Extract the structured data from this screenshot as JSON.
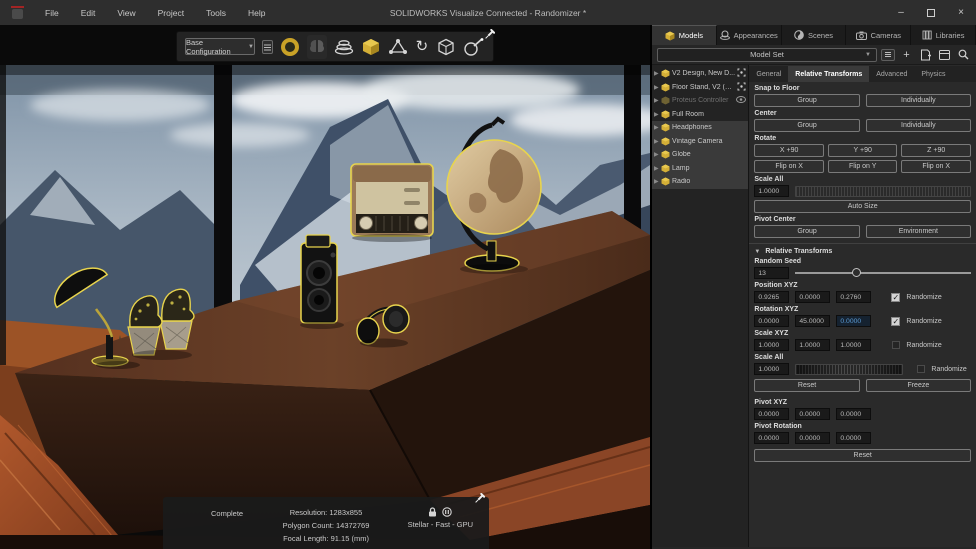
{
  "titlebar": {
    "menus": [
      "File",
      "Edit",
      "View",
      "Project",
      "Tools",
      "Help"
    ],
    "title": "SOLIDWORKS Visualize Connected - Randomizer *",
    "window_controls": {
      "minimize": "–",
      "close": "×"
    }
  },
  "toolbar": {
    "configuration_value": "Base Configuration",
    "icons": [
      "configuration-list",
      "render-ring",
      "ai-brain",
      "denoiser-stack",
      "model-cube",
      "triad-move",
      "rotate",
      "bounding-box",
      "randomizer-wand",
      "pin"
    ]
  },
  "right_panel": {
    "tabs": [
      {
        "label": "Models",
        "active": true
      },
      {
        "label": "Appearances",
        "active": false
      },
      {
        "label": "Scenes",
        "active": false
      },
      {
        "label": "Cameras",
        "active": false
      },
      {
        "label": "Libraries",
        "active": false
      }
    ],
    "model_set": {
      "value": "Model Set"
    },
    "tree": {
      "items": [
        {
          "label": "V2 Design, New D...",
          "trailing": "target",
          "dimmed": false,
          "selected": false
        },
        {
          "label": "Floor Stand, V2 (D...",
          "trailing": "target",
          "dimmed": false,
          "selected": false
        },
        {
          "label": "Proteus Controller",
          "trailing": "eye",
          "dimmed": true,
          "selected": false
        },
        {
          "label": "Full Room",
          "trailing": "",
          "dimmed": false,
          "selected": false
        },
        {
          "label": "Headphones",
          "trailing": "",
          "dimmed": false,
          "selected": true
        },
        {
          "label": "Vintage Camera",
          "trailing": "",
          "dimmed": false,
          "selected": true
        },
        {
          "label": "Globe",
          "trailing": "",
          "dimmed": false,
          "selected": true
        },
        {
          "label": "Lamp",
          "trailing": "",
          "dimmed": false,
          "selected": true
        },
        {
          "label": "Radio",
          "trailing": "",
          "dimmed": false,
          "selected": true
        }
      ]
    },
    "props_tabs": [
      {
        "label": "General",
        "active": false
      },
      {
        "label": "Relative Transforms",
        "active": true
      },
      {
        "label": "Advanced",
        "active": false
      },
      {
        "label": "Physics",
        "active": false
      }
    ],
    "sections": {
      "snap_to_floor": {
        "label": "Snap to Floor",
        "buttons": [
          "Group",
          "Individually"
        ]
      },
      "center": {
        "label": "Center",
        "buttons": [
          "Group",
          "Individually"
        ]
      },
      "rotate": {
        "label": "Rotate",
        "row1": [
          "X +90",
          "Y +90",
          "Z +90"
        ],
        "row2": [
          "Flip on X",
          "Flip on Y",
          "Flip on X"
        ]
      },
      "scale_all": {
        "label": "Scale All",
        "value": "1.0000"
      },
      "auto_size_label": "Auto Size",
      "pivot_center": {
        "label": "Pivot Center",
        "buttons": [
          "Group",
          "Environment"
        ]
      },
      "relative_transforms": {
        "header": "Relative Transforms",
        "random_seed": {
          "label": "Random Seed",
          "value": "13"
        },
        "position": {
          "label": "Position XYZ",
          "values": [
            "0.9265",
            "0.0000",
            "0.2760"
          ],
          "randomize": true
        },
        "rotation": {
          "label": "Rotation XYZ",
          "values": [
            "0.0000",
            "45.0000",
            "0.0000"
          ],
          "randomize": true,
          "highlighted_field": 2
        },
        "scale_xyz": {
          "label": "Scale XYZ",
          "values": [
            "1.0000",
            "1.0000",
            "1.0000"
          ],
          "randomize": false
        },
        "scale_all": {
          "label": "Scale All",
          "value": "1.0000",
          "randomize": false
        },
        "reset_label": "Reset",
        "freeze_label": "Freeze",
        "pivot_xyz": {
          "label": "Pivot XYZ",
          "values": [
            "0.0000",
            "0.0000",
            "0.0000"
          ]
        },
        "pivot_rotation": {
          "label": "Pivot Rotation",
          "values": [
            "0.0000",
            "0.0000",
            "0.0000"
          ]
        },
        "reset_bottom_label": "Reset"
      },
      "randomize_label": "Randomize"
    }
  },
  "status_bar": {
    "left": "Complete",
    "resolution": "Resolution: 1283x855",
    "polygon_count": "Polygon Count: 14372769",
    "focal_length": "Focal Length: 91.15 (mm)",
    "renderer": "Stellar - Fast - GPU",
    "icons": [
      "lock",
      "pause"
    ]
  },
  "viewport": {
    "selected_objects": [
      "Lamp",
      "Plant Baskets",
      "Vintage Camera",
      "Headphones",
      "Radio",
      "Globe"
    ],
    "selection_color": "#e8d44d"
  },
  "colors": {
    "selection_yellow": "#e8d44d",
    "cube_gold": "#c9a227",
    "highlight_blue": "#5b9bd5",
    "panel_bg": "#262626",
    "titlebar_bg": "#2e2e2e"
  }
}
